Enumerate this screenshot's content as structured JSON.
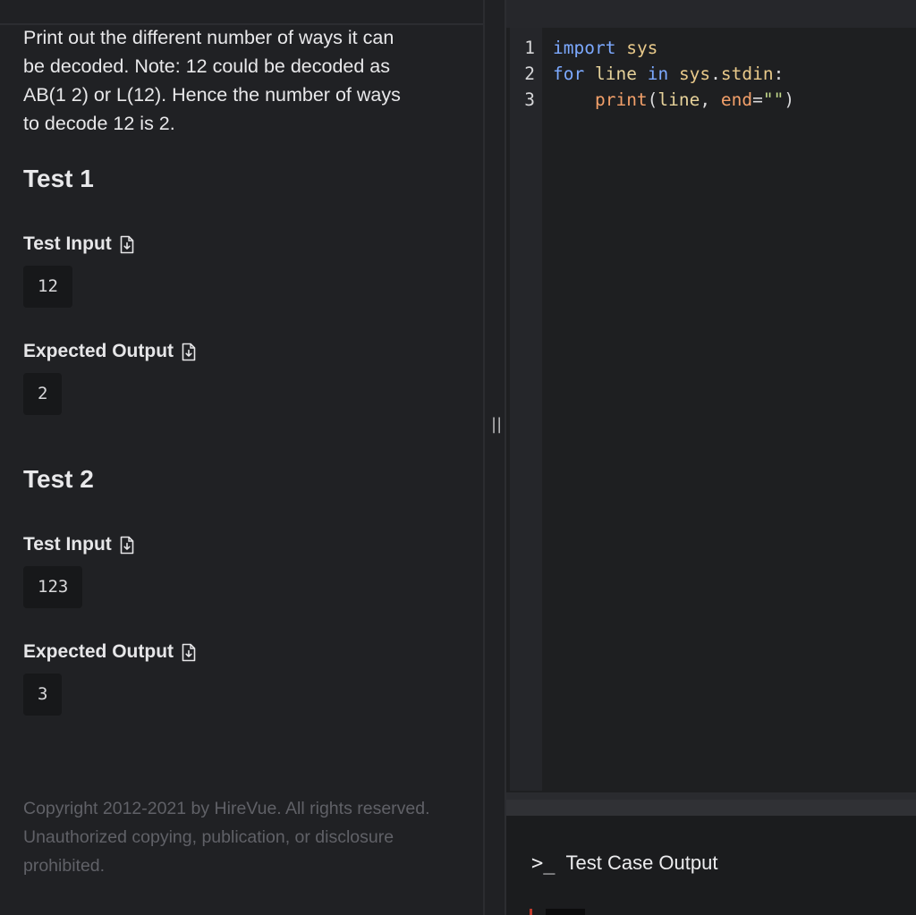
{
  "problem": {
    "description": "Print out the different number of ways it can\nbe decoded. Note: 12 could be decoded as\nAB(1 2) or L(12). Hence the number of ways\nto decode 12 is 2."
  },
  "tests": [
    {
      "heading": "Test 1",
      "input_label": "Test Input",
      "input_value": "12",
      "output_label": "Expected Output",
      "output_value": "2"
    },
    {
      "heading": "Test 2",
      "input_label": "Test Input",
      "input_value": "123",
      "output_label": "Expected Output",
      "output_value": "3"
    }
  ],
  "footer": {
    "copyright": "Copyright 2012-2021 by HireVue. All rights reserved. Unauthorized copying, publication, or disclosure prohibited."
  },
  "divider": {
    "handle_glyph": "||"
  },
  "editor": {
    "lines": [
      {
        "number": "1",
        "tokens": [
          {
            "text": "import",
            "kind": "kw"
          },
          {
            "text": " ",
            "kind": "plain"
          },
          {
            "text": "sys",
            "kind": "name"
          }
        ]
      },
      {
        "number": "2",
        "tokens": [
          {
            "text": "for",
            "kind": "kw"
          },
          {
            "text": " ",
            "kind": "plain"
          },
          {
            "text": "line",
            "kind": "id"
          },
          {
            "text": " ",
            "kind": "plain"
          },
          {
            "text": "in",
            "kind": "kw"
          },
          {
            "text": " ",
            "kind": "plain"
          },
          {
            "text": "sys",
            "kind": "name"
          },
          {
            "text": ".",
            "kind": "plain"
          },
          {
            "text": "stdin",
            "kind": "name"
          },
          {
            "text": ":",
            "kind": "plain"
          }
        ]
      },
      {
        "number": "3",
        "tokens": [
          {
            "text": "    ",
            "kind": "plain"
          },
          {
            "text": "print",
            "kind": "fn"
          },
          {
            "text": "(",
            "kind": "plain"
          },
          {
            "text": "line",
            "kind": "id"
          },
          {
            "text": ", ",
            "kind": "plain"
          },
          {
            "text": "end",
            "kind": "fn"
          },
          {
            "text": "=",
            "kind": "plain"
          },
          {
            "text": "\"\"",
            "kind": "str"
          },
          {
            "text": ")",
            "kind": "plain"
          }
        ]
      }
    ]
  },
  "output_panel": {
    "tab_icon": ">_",
    "tab_label": "Test Case Output"
  },
  "colors": {
    "background": "#202124",
    "keyword": "#7ca9ff",
    "string": "#c2d88a",
    "function": "#f3a06a",
    "muted_text": "#606167"
  },
  "icons": {
    "file_download": "file-download-icon",
    "terminal": "terminal-icon",
    "resize_handle": "resize-handle-icon"
  }
}
